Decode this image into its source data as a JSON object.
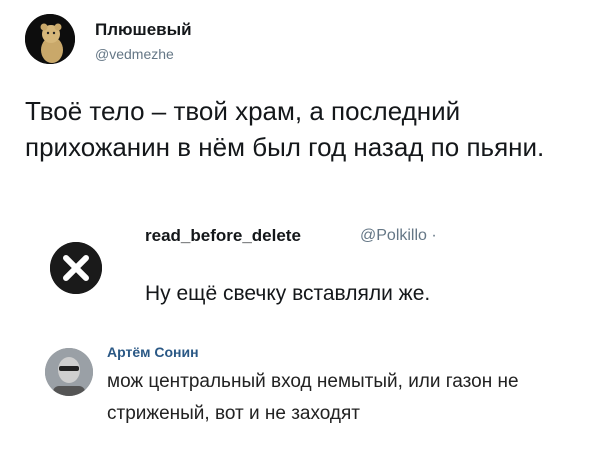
{
  "tweet": {
    "author_name": "Плюшевый",
    "author_handle": "@vedmezhe",
    "text": "Твоё тело – твой храм, а последний прихожанин в нём был год назад по пьяни."
  },
  "reply": {
    "author_name": "read_before_delete",
    "author_handle": "@Polkillo ·",
    "text": "Ну ещё свечку вставляли же.",
    "avatar_icon": "x-circle-icon"
  },
  "comment": {
    "author_name": "Артём Сонин",
    "text": "мож центральный вход немытый, или газон не стриженый, вот и не заходят"
  }
}
